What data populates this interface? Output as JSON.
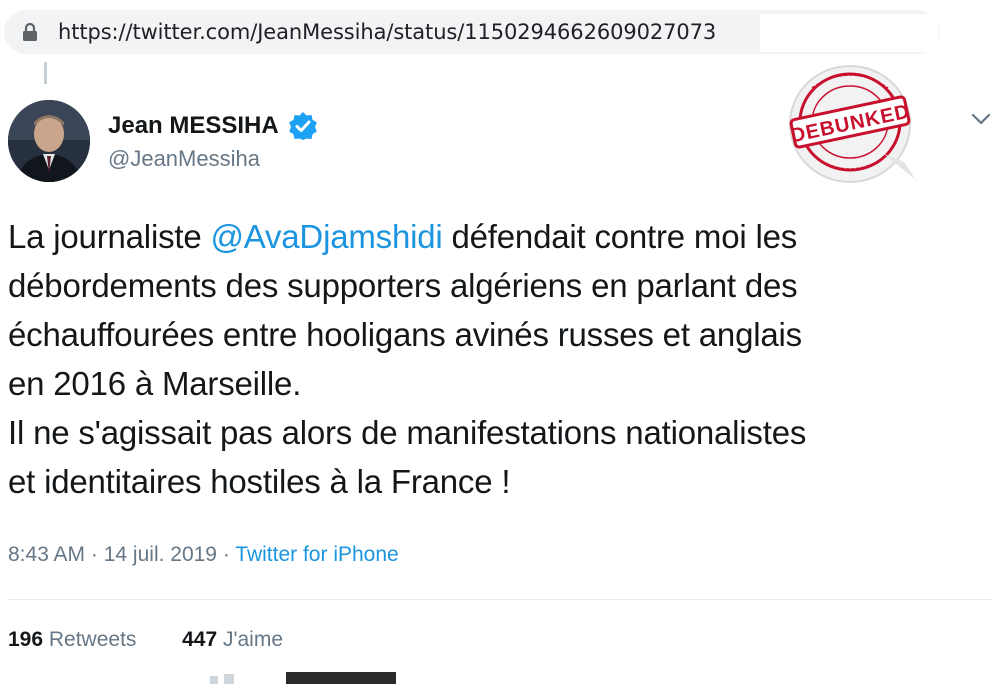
{
  "browser": {
    "url": "https://twitter.com/JeanMessiha/status/1150294662609027073",
    "icons": [
      "lock-icon"
    ]
  },
  "tweet": {
    "author_name": "Jean MESSIHA",
    "author_handle": "@JeanMessiha",
    "verified": true,
    "text_before_mention": "La journaliste ",
    "mention": "@AvaDjamshidi",
    "text_after_mention": " défendait contre moi les\ndébordements des supporters algériens en parlant des\néchauffourées entre hooligans avinés russes et anglais\nen 2016 à Marseille.\nIl ne s'agissait pas alors de manifestations nationalistes\net identitaires hostiles à la France !",
    "time": "8:43 AM",
    "separator": " · ",
    "date": "14 juil. 2019",
    "source": "Twitter for iPhone",
    "retweets_count": "196",
    "retweets_label": " Retweets",
    "likes_count": "447",
    "likes_label": " J'aime"
  },
  "stamp": {
    "label": "DEBUNKED"
  },
  "colors": {
    "link": "#1b95e0",
    "secondary_text": "#657786",
    "verified": "#1da1f2",
    "stamp_red": "#c8102e"
  }
}
